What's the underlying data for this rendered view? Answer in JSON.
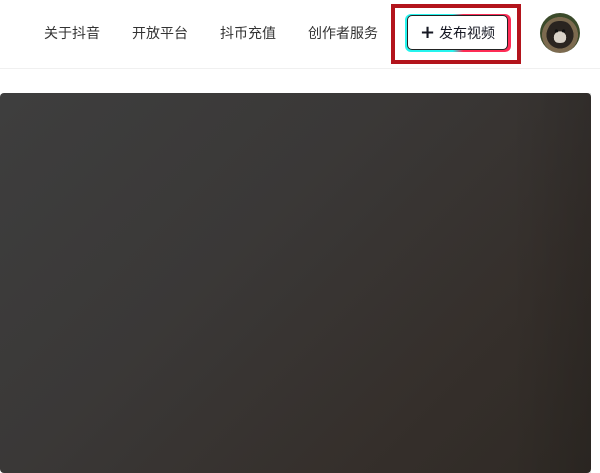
{
  "header": {
    "nav": [
      {
        "label": "关于抖音"
      },
      {
        "label": "开放平台"
      },
      {
        "label": "抖币充值"
      },
      {
        "label": "创作者服务"
      }
    ],
    "publish_button": {
      "icon": "plus-icon",
      "label": "发布视频"
    },
    "avatar": {
      "icon": "user-avatar"
    }
  },
  "colors": {
    "highlight_border": "#b3141c",
    "accent_cyan": "#25f4ee",
    "accent_pink": "#fe2c55",
    "video_bg": "#3a3837"
  }
}
